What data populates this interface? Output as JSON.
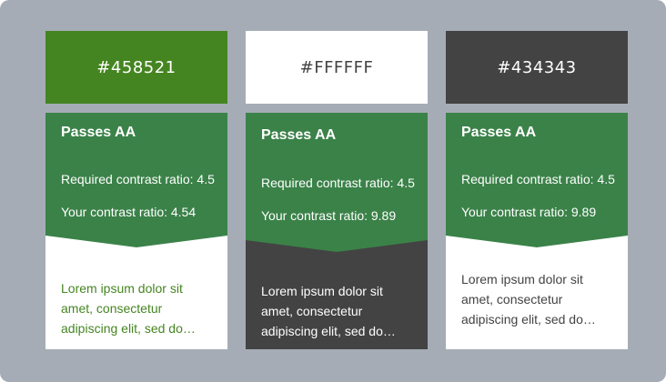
{
  "cards": [
    {
      "hex": "#458521",
      "swatch_bg": "#458521",
      "swatch_fg": "#ffffff",
      "status": "Passes AA",
      "required": "Required contrast ratio: 4.5",
      "yours": "Your contrast ratio: 4.54",
      "sample_text": "Lorem ipsum dolor sit amet, consectetur adipiscing elit, sed do…",
      "sample_bg": "#ffffff",
      "sample_fg": "#458521"
    },
    {
      "hex": "#FFFFFF",
      "swatch_bg": "#ffffff",
      "swatch_fg": "#434343",
      "status": "Passes AA",
      "required": "Required contrast ratio: 4.5",
      "yours": "Your contrast ratio: 9.89",
      "sample_text": "Lorem ipsum dolor sit amet, consectetur adipiscing elit, sed do…",
      "sample_bg": "#434343",
      "sample_fg": "#ffffff"
    },
    {
      "hex": "#434343",
      "swatch_bg": "#434343",
      "swatch_fg": "#ffffff",
      "status": "Passes AA",
      "required": "Required contrast ratio: 4.5",
      "yours": "Your contrast ratio: 9.89",
      "sample_text": "Lorem ipsum dolor sit amet, consectetur adipiscing elit, sed do…",
      "sample_bg": "#ffffff",
      "sample_fg": "#434343"
    }
  ],
  "colors": {
    "frame": "#a5acb6",
    "pass_green": "#3b8249"
  }
}
